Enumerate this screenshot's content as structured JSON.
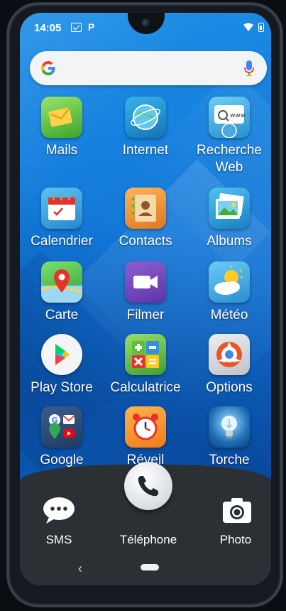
{
  "status": {
    "time": "14:05",
    "p_badge": "P"
  },
  "search": {
    "logo": "google-g-logo",
    "icon": "microphone-icon"
  },
  "apps": [
    {
      "label": "Mails",
      "icon": "mail-icon"
    },
    {
      "label": "Internet",
      "icon": "globe-icon"
    },
    {
      "label": "Recherche Web",
      "icon": "web-search-icon",
      "icon_text": "www"
    },
    {
      "label": "Calendrier",
      "icon": "calendar-icon"
    },
    {
      "label": "Contacts",
      "icon": "contacts-book-icon"
    },
    {
      "label": "Albums",
      "icon": "photo-albums-icon"
    },
    {
      "label": "Carte",
      "icon": "map-pin-icon"
    },
    {
      "label": "Filmer",
      "icon": "video-camera-icon"
    },
    {
      "label": "Météo",
      "icon": "weather-sun-cloud-icon"
    },
    {
      "label": "Play Store",
      "icon": "play-store-icon"
    },
    {
      "label": "Calculatrice",
      "icon": "calculator-icon"
    },
    {
      "label": "Options",
      "icon": "options-icon"
    },
    {
      "label": "Google",
      "icon": "google-folder-icon"
    },
    {
      "label": "Réveil",
      "icon": "alarm-clock-icon"
    },
    {
      "label": "Torche",
      "icon": "flashlight-bulb-icon"
    }
  ],
  "dock": [
    {
      "label": "SMS",
      "icon": "sms-chat-icon"
    },
    {
      "label": "Téléphone",
      "icon": "phone-handset-icon"
    },
    {
      "label": "Photo",
      "icon": "camera-icon"
    }
  ],
  "nav": {
    "back": "‹"
  },
  "colors": {
    "wallpaper": "#1277d8",
    "dock": "#2b3034"
  }
}
